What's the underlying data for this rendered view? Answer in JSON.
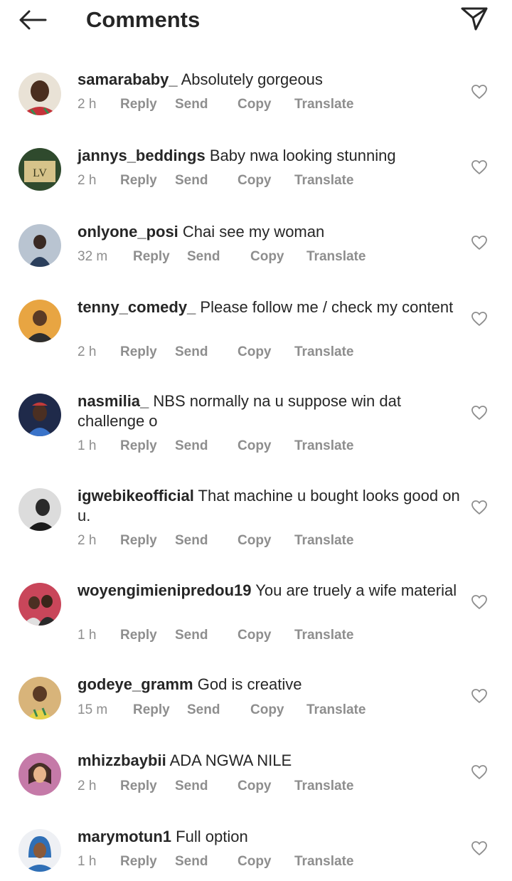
{
  "header": {
    "title": "Comments",
    "back_icon": "arrow-left-icon",
    "share_icon": "paper-plane-icon"
  },
  "action_labels": {
    "reply": "Reply",
    "send": "Send",
    "copy": "Copy",
    "translate": "Translate"
  },
  "colors": {
    "text": "#262626",
    "muted": "#8e8e8e",
    "background": "#ffffff"
  },
  "comments": [
    {
      "username": "samarababy_",
      "text": "Absolutely gorgeous",
      "time": "2 h"
    },
    {
      "username": "jannys_beddings",
      "text": "Baby nwa looking stunning",
      "time": "2 h"
    },
    {
      "username": "onlyone_posi",
      "text": "Chai see my woman",
      "time": "32 m"
    },
    {
      "username": "tenny_comedy_",
      "text": "Please follow me / check my content",
      "time": "2 h"
    },
    {
      "username": "nasmilia_",
      "text": "NBS normally na u suppose win dat challenge o",
      "time": "1 h"
    },
    {
      "username": "igwebikeofficial",
      "text": "That machine u bought looks good on u.",
      "time": "2 h"
    },
    {
      "username": "woyengimienipredou19",
      "text": "You are truely a wife material",
      "time": "1 h"
    },
    {
      "username": "godeye_gramm",
      "text": "God is creative",
      "time": "15 m"
    },
    {
      "username": "mhizzbaybii",
      "text": "ADA NGWA NILE",
      "time": "2 h"
    },
    {
      "username": "marymotun1",
      "text": "Full option",
      "time": "1 h"
    }
  ]
}
